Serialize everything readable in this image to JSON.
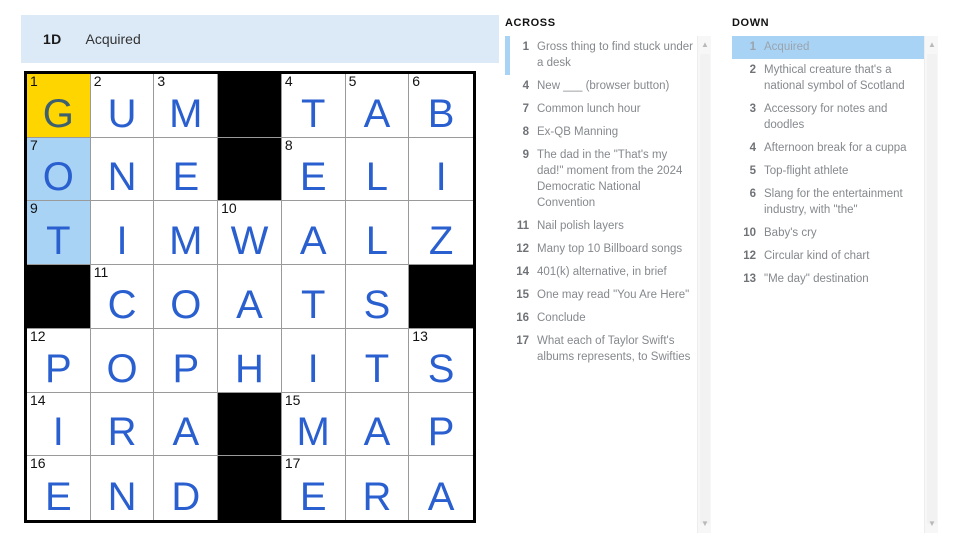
{
  "current_clue": {
    "number": "1D",
    "text": "Acquired"
  },
  "colors": {
    "active_cell": "#ffd500",
    "word_highlight": "#a9d3f5",
    "letter": "#2a5fd0",
    "clue_bar_bg": "#dceaf7"
  },
  "grid": {
    "rows": 7,
    "cols": 7,
    "cells": [
      [
        {
          "num": "1",
          "letter": "G",
          "state": "active"
        },
        {
          "num": "2",
          "letter": "U",
          "state": "normal"
        },
        {
          "num": "3",
          "letter": "M",
          "state": "normal"
        },
        {
          "num": "",
          "letter": "",
          "state": "block"
        },
        {
          "num": "4",
          "letter": "T",
          "state": "normal"
        },
        {
          "num": "5",
          "letter": "A",
          "state": "normal"
        },
        {
          "num": "6",
          "letter": "B",
          "state": "normal"
        }
      ],
      [
        {
          "num": "7",
          "letter": "O",
          "state": "word"
        },
        {
          "num": "",
          "letter": "N",
          "state": "normal"
        },
        {
          "num": "",
          "letter": "E",
          "state": "normal"
        },
        {
          "num": "",
          "letter": "",
          "state": "block"
        },
        {
          "num": "8",
          "letter": "E",
          "state": "normal"
        },
        {
          "num": "",
          "letter": "L",
          "state": "normal"
        },
        {
          "num": "",
          "letter": "I",
          "state": "normal"
        }
      ],
      [
        {
          "num": "9",
          "letter": "T",
          "state": "word"
        },
        {
          "num": "",
          "letter": "I",
          "state": "normal"
        },
        {
          "num": "",
          "letter": "M",
          "state": "normal"
        },
        {
          "num": "10",
          "letter": "W",
          "state": "normal"
        },
        {
          "num": "",
          "letter": "A",
          "state": "normal"
        },
        {
          "num": "",
          "letter": "L",
          "state": "normal"
        },
        {
          "num": "",
          "letter": "Z",
          "state": "normal"
        }
      ],
      [
        {
          "num": "",
          "letter": "",
          "state": "block"
        },
        {
          "num": "11",
          "letter": "C",
          "state": "normal"
        },
        {
          "num": "",
          "letter": "O",
          "state": "normal"
        },
        {
          "num": "",
          "letter": "A",
          "state": "normal"
        },
        {
          "num": "",
          "letter": "T",
          "state": "normal"
        },
        {
          "num": "",
          "letter": "S",
          "state": "normal"
        },
        {
          "num": "",
          "letter": "",
          "state": "block"
        }
      ],
      [
        {
          "num": "12",
          "letter": "P",
          "state": "normal"
        },
        {
          "num": "",
          "letter": "O",
          "state": "normal"
        },
        {
          "num": "",
          "letter": "P",
          "state": "normal"
        },
        {
          "num": "",
          "letter": "H",
          "state": "normal"
        },
        {
          "num": "",
          "letter": "I",
          "state": "normal"
        },
        {
          "num": "",
          "letter": "T",
          "state": "normal"
        },
        {
          "num": "13",
          "letter": "S",
          "state": "normal"
        }
      ],
      [
        {
          "num": "14",
          "letter": "I",
          "state": "normal"
        },
        {
          "num": "",
          "letter": "R",
          "state": "normal"
        },
        {
          "num": "",
          "letter": "A",
          "state": "normal"
        },
        {
          "num": "",
          "letter": "",
          "state": "block"
        },
        {
          "num": "15",
          "letter": "M",
          "state": "normal"
        },
        {
          "num": "",
          "letter": "A",
          "state": "normal"
        },
        {
          "num": "",
          "letter": "P",
          "state": "normal"
        }
      ],
      [
        {
          "num": "16",
          "letter": "E",
          "state": "normal"
        },
        {
          "num": "",
          "letter": "N",
          "state": "normal"
        },
        {
          "num": "",
          "letter": "D",
          "state": "normal"
        },
        {
          "num": "",
          "letter": "",
          "state": "block"
        },
        {
          "num": "17",
          "letter": "E",
          "state": "normal"
        },
        {
          "num": "",
          "letter": "R",
          "state": "normal"
        },
        {
          "num": "",
          "letter": "A",
          "state": "normal"
        }
      ]
    ]
  },
  "across": {
    "heading": "ACROSS",
    "clues": [
      {
        "num": "1",
        "text": "Gross thing to find stuck under a desk",
        "selected": "crossing"
      },
      {
        "num": "4",
        "text": "New ___ (browser button)",
        "selected": "none"
      },
      {
        "num": "7",
        "text": "Common lunch hour",
        "selected": "none"
      },
      {
        "num": "8",
        "text": "Ex-QB Manning",
        "selected": "none"
      },
      {
        "num": "9",
        "text": "The dad in the \"That's my dad!\" moment from the 2024 Democratic National Convention",
        "selected": "none"
      },
      {
        "num": "11",
        "text": "Nail polish layers",
        "selected": "none"
      },
      {
        "num": "12",
        "text": "Many top 10 Billboard songs",
        "selected": "none"
      },
      {
        "num": "14",
        "text": "401(k) alternative, in brief",
        "selected": "none"
      },
      {
        "num": "15",
        "text": "One may read \"You Are Here\"",
        "selected": "none"
      },
      {
        "num": "16",
        "text": "Conclude",
        "selected": "none"
      },
      {
        "num": "17",
        "text": "What each of Taylor Swift's albums represents, to Swifties",
        "selected": "none"
      }
    ]
  },
  "down": {
    "heading": "DOWN",
    "clues": [
      {
        "num": "1",
        "text": "Acquired",
        "selected": "active"
      },
      {
        "num": "2",
        "text": "Mythical creature that's a national symbol of Scotland",
        "selected": "none"
      },
      {
        "num": "3",
        "text": "Accessory for notes and doodles",
        "selected": "none"
      },
      {
        "num": "4",
        "text": "Afternoon break for a cuppa",
        "selected": "none"
      },
      {
        "num": "5",
        "text": "Top-flight athlete",
        "selected": "none"
      },
      {
        "num": "6",
        "text": "Slang for the entertainment industry, with \"the\"",
        "selected": "none"
      },
      {
        "num": "10",
        "text": "Baby's cry",
        "selected": "none"
      },
      {
        "num": "12",
        "text": "Circular kind of chart",
        "selected": "none"
      },
      {
        "num": "13",
        "text": "\"Me day\" destination",
        "selected": "none"
      }
    ]
  },
  "scrollbars": {
    "across": {
      "up_arrow": "▲",
      "down_arrow": "▼"
    },
    "down": {
      "up_arrow": "▲",
      "down_arrow": "▼"
    }
  }
}
